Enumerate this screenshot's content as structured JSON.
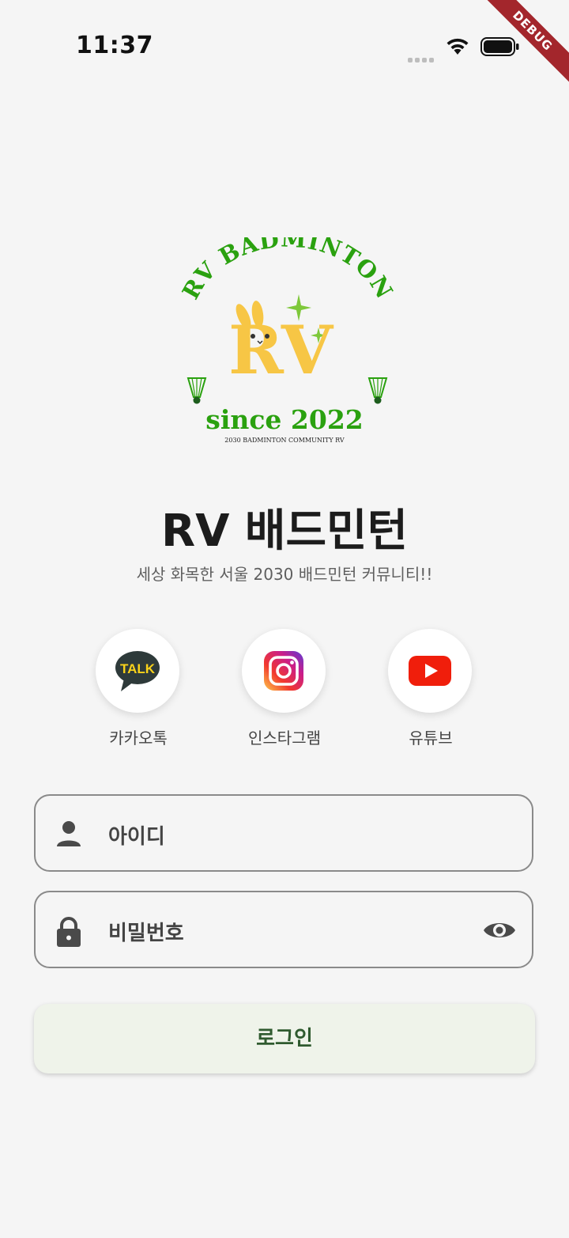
{
  "status_bar": {
    "time": "11:37",
    "debug_label": "DEBUG"
  },
  "logo": {
    "arc_text": "RV BADMINTON",
    "initials": "RV",
    "since_text": "since 2022",
    "community_text": "2030 BADMINTON COMMUNITY RV",
    "brand_green": "#2aa10f",
    "bunny_yellow": "#f7c645"
  },
  "app": {
    "title": "RV 배드민턴",
    "subtitle": "세상 화목한 서울 2030 배드민턴 커뮤니티!!"
  },
  "social": [
    {
      "label": "카카오톡",
      "icon": "kakaotalk-icon",
      "icon_text": "TALK"
    },
    {
      "label": "인스타그램",
      "icon": "instagram-icon"
    },
    {
      "label": "유튜브",
      "icon": "youtube-icon"
    }
  ],
  "form": {
    "id_placeholder": "아이디",
    "password_placeholder": "비밀번호",
    "login_label": "로그인"
  }
}
